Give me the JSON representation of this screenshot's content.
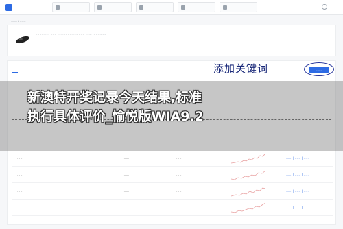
{
  "header": {
    "logo_text": "……",
    "nav": [
      {
        "label": "……",
        "icon": "grid-icon"
      },
      {
        "label": "……",
        "icon": "chart-icon"
      },
      {
        "label": "……",
        "icon": "doc-icon"
      },
      {
        "label": "……",
        "icon": "list-icon"
      },
      {
        "label": "……",
        "icon": "settings-icon"
      }
    ],
    "user_name": "……"
  },
  "breadcrumb": "…… / ……",
  "product": {
    "title": "…… …… …… …… …… …… …… …… …… ……",
    "meta": [
      "……",
      "……",
      "……",
      "……",
      "……",
      "……"
    ]
  },
  "card": {
    "tabs": [
      "……",
      "……",
      "……",
      "……"
    ],
    "handwritten_annotation": "添加关键词",
    "add_keyword_button": "……",
    "filter_placeholder": "……",
    "rows": [
      {
        "keyword": "……",
        "value": "……",
        "status": "……",
        "actions": "…… | …… | ……"
      },
      {
        "keyword": "……",
        "value": "……",
        "status": "……",
        "actions": "…… | …… | ……"
      },
      {
        "keyword": "……",
        "value": "……",
        "status": "……",
        "actions": "…… | …… | ……"
      },
      {
        "keyword": "……",
        "value": "……",
        "status": "……",
        "actions": "…… | …… | ……"
      }
    ]
  },
  "overlay": {
    "banner_line1": "新澳特开奖记录今天结果,标准",
    "banner_line2": "执行具体评价_愉悦版WIA9.2"
  },
  "colors": {
    "accent": "#2d6be4",
    "annotation_ink": "#1b2a7a"
  }
}
